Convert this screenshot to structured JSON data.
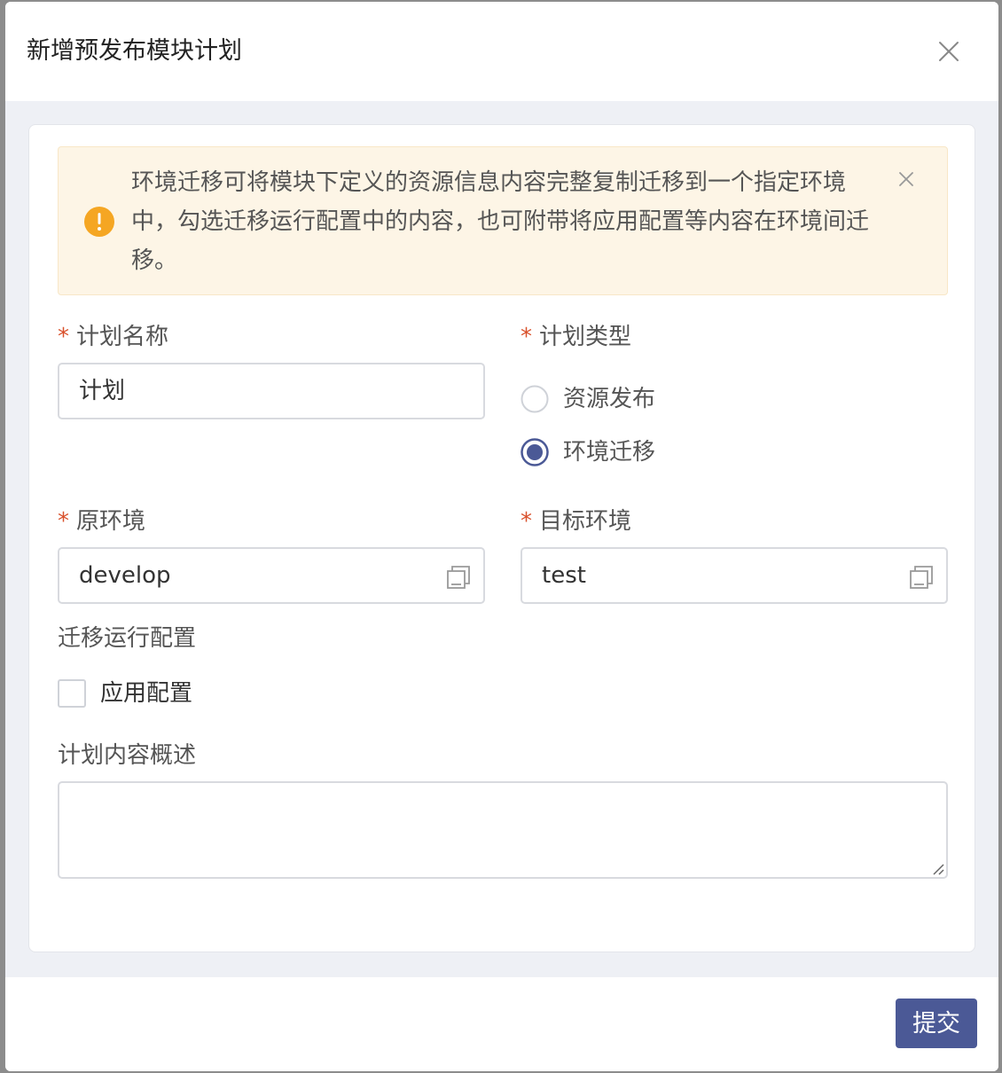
{
  "modal": {
    "title": "新增预发布模块计划",
    "submit_label": "提交"
  },
  "alert": {
    "text": "环境迁移可将模块下定义的资源信息内容完整复制迁移到一个指定环境中，勾选迁移运行配置中的内容，也可附带将应用配置等内容在环境间迁移。"
  },
  "form": {
    "required_mark": "*",
    "plan_name": {
      "label": "计划名称",
      "value": "计划"
    },
    "plan_type": {
      "label": "计划类型",
      "options": [
        "资源发布",
        "环境迁移"
      ],
      "selected": "环境迁移"
    },
    "source_env": {
      "label": "原环境",
      "value": "develop"
    },
    "target_env": {
      "label": "目标环境",
      "value": "test"
    },
    "migrate_config": {
      "label": "迁移运行配置",
      "checkbox_label": "应用配置",
      "checked": false
    },
    "description": {
      "label": "计划内容概述",
      "value": ""
    }
  },
  "colors": {
    "accent": "#4b5996",
    "required": "#d9512c",
    "warning": "#f5a623",
    "alert_bg": "#fdf5e6"
  }
}
